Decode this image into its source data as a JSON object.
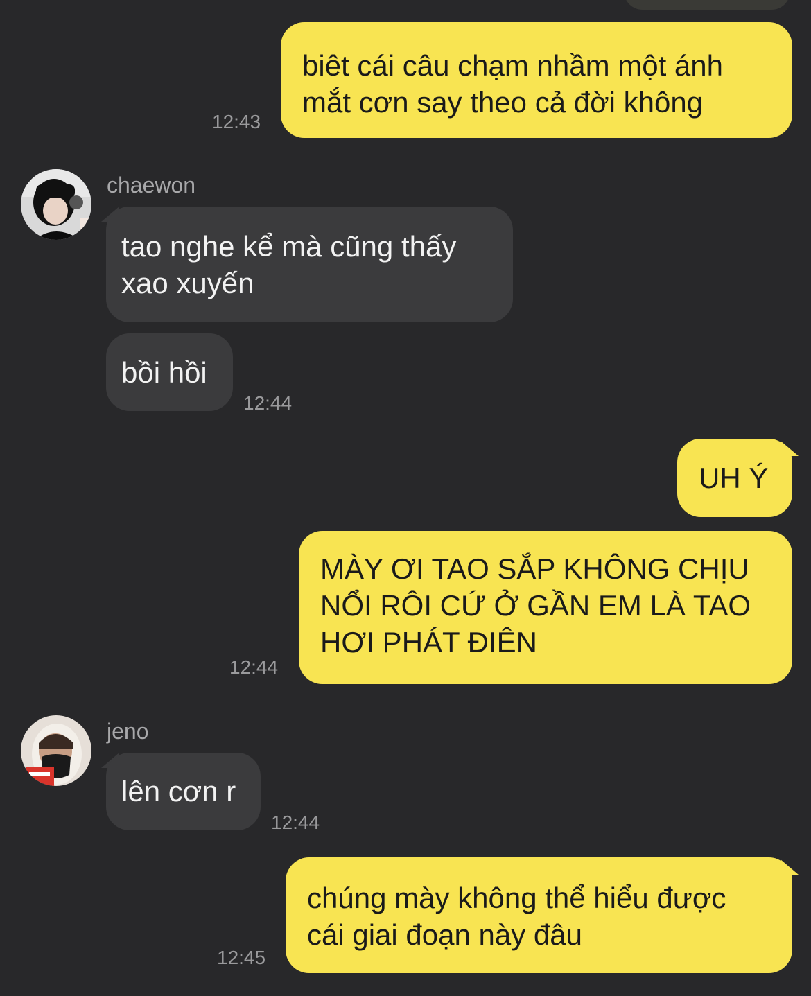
{
  "colors": {
    "background": "#28282a",
    "outgoing": "#f8e452",
    "incoming": "#3b3b3d"
  },
  "messages": {
    "m1": {
      "text": "biêt cái câu chạm nhầm một ánh\nmắt cơn say theo cả đời không",
      "time": "12:43"
    },
    "chaewon": {
      "name": "chaewon",
      "msg1": "tao nghe kể mà cũng thấy\nxao xuyến",
      "msg2": "bồi hồi",
      "time": "12:44"
    },
    "m3": {
      "text": "UH Ý"
    },
    "m4": {
      "text": "MÀY ƠI TAO SẮP KHÔNG CHỊU\nNỔI RÔI CỨ Ở GẦN EM LÀ TAO\nHƠI PHÁT ĐIÊN",
      "time": "12:44"
    },
    "jeno": {
      "name": "jeno",
      "msg1": "lên cơn r",
      "time": "12:44"
    },
    "m5": {
      "text": "chúng mày không thể hiểu được\ncái giai đoạn này đâu",
      "time": "12:45"
    }
  }
}
